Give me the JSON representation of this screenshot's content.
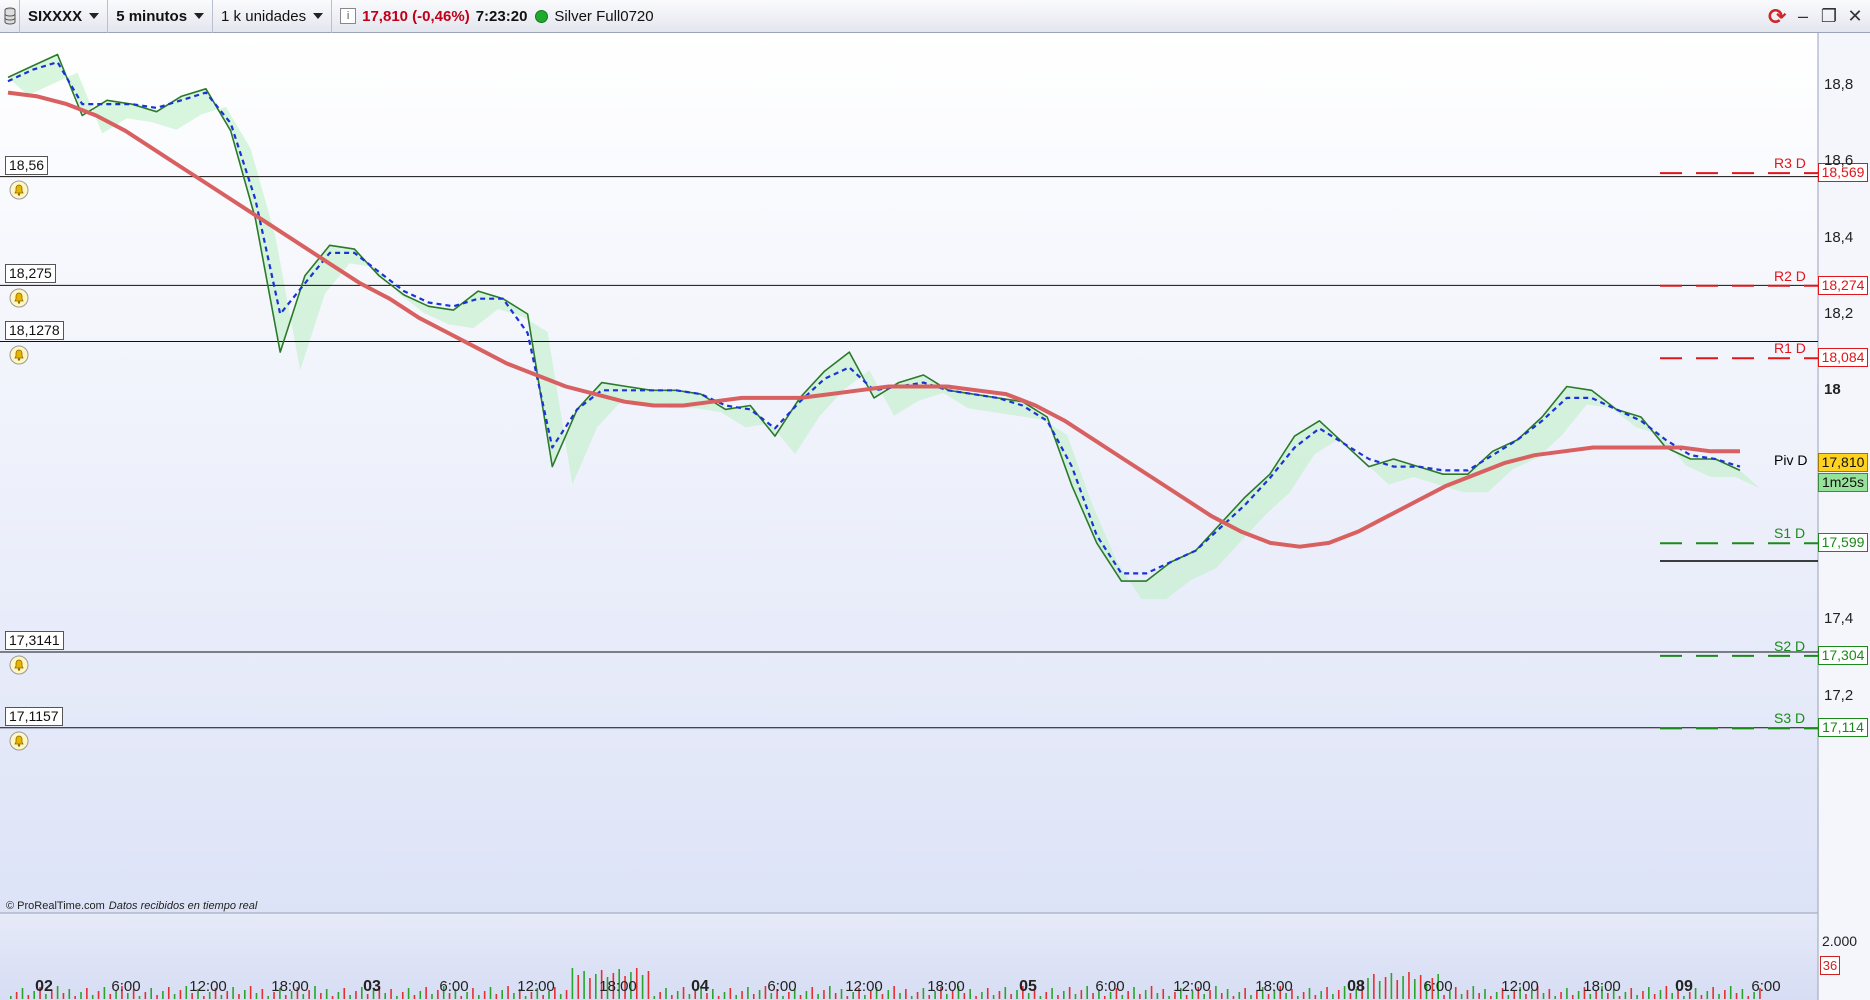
{
  "toolbar": {
    "instrument": "SIXXXX",
    "timeframe": "5 minutos",
    "units": "1 k unidades",
    "info": "i",
    "price_change": "17,810 (-0,46%)",
    "time": "7:23:20",
    "account": "Silver Full0720"
  },
  "alert_lines": [
    {
      "label": "18,56",
      "value": 18.56
    },
    {
      "label": "18,275",
      "value": 18.275
    },
    {
      "label": "18,1278",
      "value": 18.1278
    },
    {
      "label": "17,3141",
      "value": 17.3141
    },
    {
      "label": "17,1157",
      "value": 17.1157
    }
  ],
  "pivots": [
    {
      "name": "R3 D",
      "label": "18,569",
      "value": 18.569,
      "color": "#e0161b"
    },
    {
      "name": "R2 D",
      "label": "18,274",
      "value": 18.274,
      "color": "#e0161b"
    },
    {
      "name": "R1 D",
      "label": "18,084",
      "value": 18.084,
      "color": "#e0161b"
    },
    {
      "name": "Piv D",
      "label": "",
      "value": 17.79,
      "color": "#000000"
    },
    {
      "name": "S1 D",
      "label": "17,599",
      "value": 17.599,
      "color": "#1b8a1b"
    },
    {
      "name": "S2 D",
      "label": "17,304",
      "value": 17.304,
      "color": "#1b8a1b"
    },
    {
      "name": "S3 D",
      "label": "17,114",
      "value": 17.114,
      "color": "#1b8a1b"
    }
  ],
  "last_price": {
    "label": "17,810",
    "value": 17.81,
    "countdown": "1m25s"
  },
  "credit": {
    "brand": "© ProRealTime.com",
    "note": "Datos recibidos en tiempo real"
  },
  "volume_axis": {
    "tick": "2.000",
    "current": "36"
  },
  "chart_data": {
    "type": "line",
    "title": "",
    "ylim": [
      17.0,
      18.9
    ],
    "yticks": [
      {
        "label": "18,8",
        "value": 18.8,
        "bold": false
      },
      {
        "label": "18,6",
        "value": 18.6,
        "bold": false
      },
      {
        "label": "18,4",
        "value": 18.4,
        "bold": false
      },
      {
        "label": "18,2",
        "value": 18.2,
        "bold": false
      },
      {
        "label": "18",
        "value": 18.0,
        "bold": true
      },
      {
        "label": "17,4",
        "value": 17.4,
        "bold": false
      },
      {
        "label": "17,2",
        "value": 17.2,
        "bold": false
      }
    ],
    "xticks": [
      {
        "label": "02",
        "bold": true
      },
      {
        "label": "6:00",
        "bold": false
      },
      {
        "label": "12:00",
        "bold": false
      },
      {
        "label": "18:00",
        "bold": false
      },
      {
        "label": "03",
        "bold": true
      },
      {
        "label": "6:00",
        "bold": false
      },
      {
        "label": "12:00",
        "bold": false
      },
      {
        "label": "18:00",
        "bold": false
      },
      {
        "label": "04",
        "bold": true
      },
      {
        "label": "6:00",
        "bold": false
      },
      {
        "label": "12:00",
        "bold": false
      },
      {
        "label": "18:00",
        "bold": false
      },
      {
        "label": "05",
        "bold": true
      },
      {
        "label": "6:00",
        "bold": false
      },
      {
        "label": "12:00",
        "bold": false
      },
      {
        "label": "18:00",
        "bold": false
      },
      {
        "label": "08",
        "bold": true
      },
      {
        "label": "6:00",
        "bold": false
      },
      {
        "label": "12:00",
        "bold": false
      },
      {
        "label": "18:00",
        "bold": false
      },
      {
        "label": "09",
        "bold": true
      },
      {
        "label": "6:00",
        "bold": false
      }
    ],
    "series": [
      {
        "values": [
          18.82,
          18.85,
          18.88,
          18.72,
          18.76,
          18.75,
          18.73,
          18.77,
          18.79,
          18.68,
          18.45,
          18.1,
          18.3,
          18.38,
          18.37,
          18.3,
          18.25,
          18.22,
          18.21,
          18.26,
          18.24,
          18.2,
          17.8,
          17.95,
          18.02,
          18.01,
          18.0,
          18.0,
          17.99,
          17.95,
          17.96,
          17.88,
          17.98,
          18.05,
          18.1,
          17.98,
          18.02,
          18.04,
          18.0,
          17.99,
          17.98,
          17.97,
          17.93,
          17.75,
          17.6,
          17.5,
          17.5,
          17.55,
          17.58,
          17.65,
          17.72,
          17.78,
          17.88,
          17.92,
          17.86,
          17.8,
          17.82,
          17.8,
          17.78,
          17.78,
          17.84,
          17.87,
          17.93,
          18.01,
          18.0,
          17.95,
          17.93,
          17.85,
          17.82,
          17.82,
          17.79
        ],
        "color": "#2a7a2a"
      },
      {
        "values": [
          18.81,
          18.84,
          18.86,
          18.75,
          18.75,
          18.75,
          18.74,
          18.76,
          18.78,
          18.7,
          18.5,
          18.2,
          18.28,
          18.36,
          18.36,
          18.31,
          18.26,
          18.23,
          18.22,
          18.24,
          18.24,
          18.15,
          17.85,
          17.95,
          18.0,
          18.0,
          18.0,
          18.0,
          17.99,
          17.96,
          17.95,
          17.9,
          17.97,
          18.03,
          18.06,
          18.0,
          18.01,
          18.02,
          18.0,
          17.99,
          17.98,
          17.96,
          17.92,
          17.8,
          17.62,
          17.52,
          17.52,
          17.55,
          17.58,
          17.64,
          17.7,
          17.77,
          17.85,
          17.9,
          17.86,
          17.82,
          17.8,
          17.8,
          17.79,
          17.79,
          17.83,
          17.87,
          17.92,
          17.98,
          17.98,
          17.95,
          17.92,
          17.87,
          17.83,
          17.82,
          17.8
        ],
        "color": "#1a33d6",
        "dashed": true
      },
      {
        "values": [
          18.78,
          18.77,
          18.75,
          18.72,
          18.68,
          18.63,
          18.58,
          18.53,
          18.48,
          18.43,
          18.38,
          18.33,
          18.28,
          18.24,
          18.19,
          18.15,
          18.11,
          18.07,
          18.04,
          18.01,
          17.99,
          17.97,
          17.96,
          17.96,
          17.97,
          17.98,
          17.98,
          17.98,
          17.99,
          18.0,
          18.01,
          18.01,
          18.01,
          18.0,
          17.99,
          17.96,
          17.92,
          17.87,
          17.82,
          17.77,
          17.72,
          17.67,
          17.63,
          17.6,
          17.59,
          17.6,
          17.63,
          17.67,
          17.71,
          17.75,
          17.78,
          17.81,
          17.83,
          17.84,
          17.85,
          17.85,
          17.85,
          17.85,
          17.84,
          17.84
        ],
        "color": "#d96060",
        "thick": true
      }
    ]
  }
}
